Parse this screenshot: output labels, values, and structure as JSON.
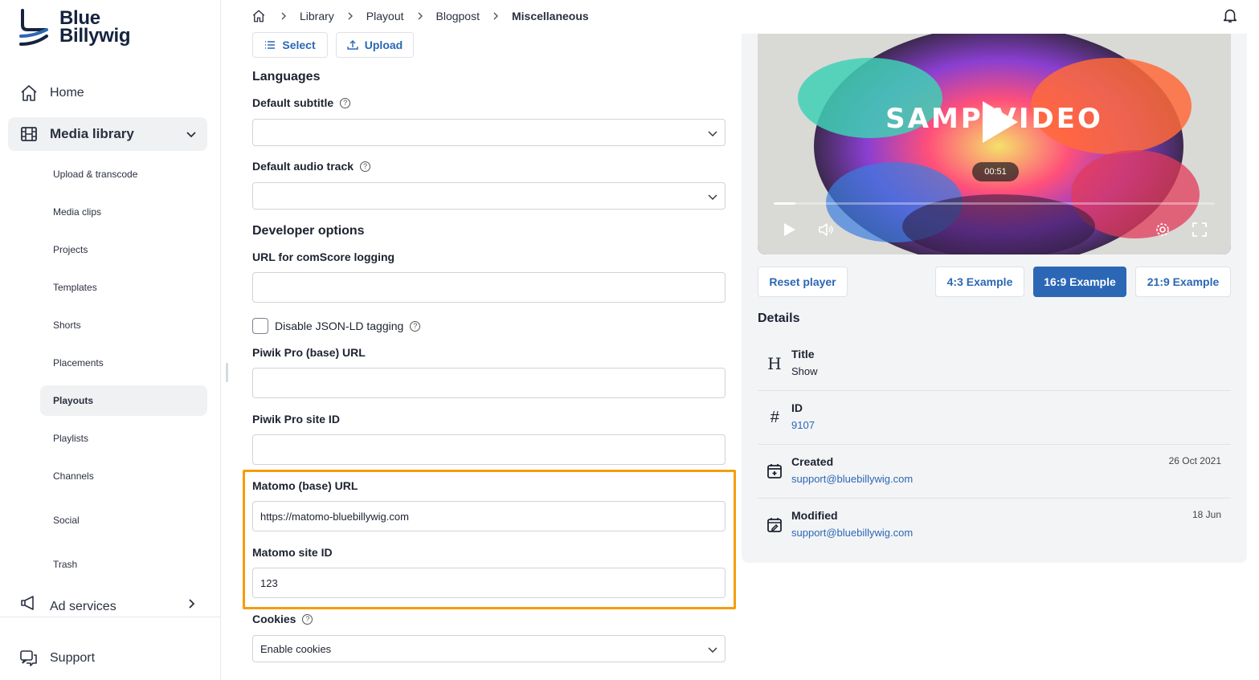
{
  "logo": {
    "line1": "Blue",
    "line2": "Billywig"
  },
  "sidebar": {
    "home": "Home",
    "media_library": "Media library",
    "sub_items": [
      "Upload & transcode",
      "Media clips",
      "Projects",
      "Templates",
      "Shorts",
      "Placements",
      "Playouts",
      "Playlists",
      "Channels",
      "Social",
      "Trash"
    ],
    "active_sub": "Playouts",
    "ad_services": "Ad services",
    "support": "Support"
  },
  "breadcrumb": {
    "items": [
      "Library",
      "Playout",
      "Blogpost"
    ],
    "current": "Miscellaneous"
  },
  "toolbar": {
    "select_label": "Select",
    "upload_label": "Upload"
  },
  "form": {
    "languages_title": "Languages",
    "default_subtitle_label": "Default subtitle",
    "default_subtitle_value": "",
    "default_audio_label": "Default audio track",
    "default_audio_value": "",
    "developer_title": "Developer options",
    "comscore_label": "URL for comScore logging",
    "comscore_value": "",
    "jsonld_label": "Disable JSON-LD tagging",
    "piwik_url_label": "Piwik Pro (base) URL",
    "piwik_url_value": "",
    "piwik_site_label": "Piwik Pro site ID",
    "piwik_site_value": "",
    "matomo_url_label": "Matomo (base) URL",
    "matomo_url_value": "https://matomo-bluebillywig.com",
    "matomo_site_label": "Matomo site ID",
    "matomo_site_value": "123",
    "cookies_label": "Cookies",
    "cookies_value": "Enable cookies"
  },
  "player": {
    "title_text": "SAMP VIDEO",
    "time": "00:51",
    "progress": 0.05,
    "buttons": {
      "reset": "Reset player",
      "ex43": "4:3 Example",
      "ex169": "16:9 Example",
      "ex219": "21:9 Example"
    }
  },
  "details": {
    "title": "Details",
    "rows": [
      {
        "label": "Title",
        "value": "Show",
        "date": ""
      },
      {
        "label": "ID",
        "value": "9107",
        "date": ""
      },
      {
        "label": "Created",
        "value": "support@bluebillywig.com",
        "date": "26 Oct 2021"
      },
      {
        "label": "Modified",
        "value": "support@bluebillywig.com",
        "date": "18 Jun"
      }
    ]
  },
  "colors": {
    "accent": "#2b67b5",
    "highlight": "#f59d0c",
    "panel": "#f3f4f6"
  }
}
